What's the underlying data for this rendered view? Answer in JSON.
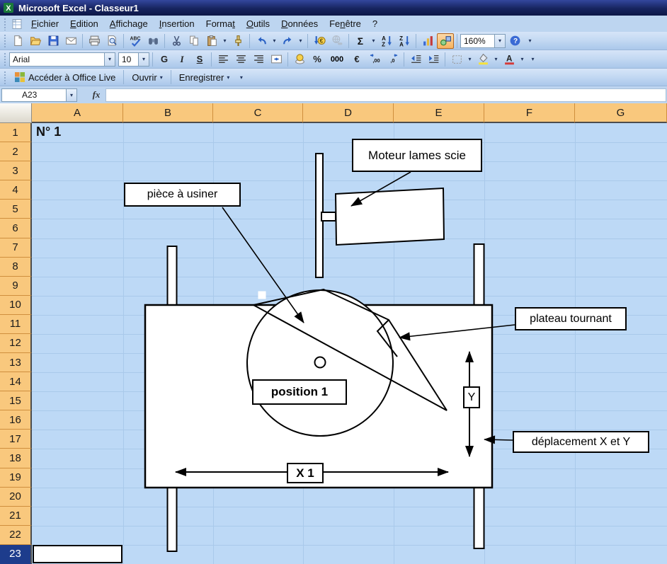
{
  "window_title": "Microsoft Excel - Classeur1",
  "menu_items": [
    {
      "label": "Fichier",
      "u": 0
    },
    {
      "label": "Edition",
      "u": 0
    },
    {
      "label": "Affichage",
      "u": 0
    },
    {
      "label": "Insertion",
      "u": 0
    },
    {
      "label": "Format",
      "u": 5
    },
    {
      "label": "Outils",
      "u": 0
    },
    {
      "label": "Données",
      "u": 0
    },
    {
      "label": "Fenêtre",
      "u": 2
    },
    {
      "label": "?",
      "u": -1
    }
  ],
  "standard_toolbar": {
    "zoom_value": "160%"
  },
  "formatting_toolbar": {
    "font_name": "Arial",
    "font_size": "10",
    "bold_label": "G",
    "italic_label": "I",
    "underline_label": "S",
    "percent": "%",
    "thousands": "000",
    "euro": "€"
  },
  "office_live_toolbar": {
    "access": "Accéder à Office Live",
    "open": "Ouvrir",
    "save": "Enregistrer"
  },
  "formula_bar": {
    "name_box": "A23",
    "fx": "fx",
    "formula": ""
  },
  "grid": {
    "columns": [
      "A",
      "B",
      "C",
      "D",
      "E",
      "F",
      "G"
    ],
    "rows": 23,
    "active_row": 23,
    "active_cell": "A23",
    "cell_a1": "N° 1"
  },
  "diagram": {
    "labels": {
      "moteur": "Moteur lames scie",
      "piece": "pièce à usiner",
      "plateau": "plateau tournant",
      "deplacement": "déplacement X et Y",
      "position": "position 1",
      "x1": "X 1",
      "y": "Y"
    }
  },
  "icons": {
    "dropdown": "▾",
    "sigma": "Σ",
    "euro": "€",
    "question": "?",
    "abc": "ABC",
    "sort_a": "A",
    "sort_z": "Z",
    "letter_a": "A",
    "x": "X",
    "dec0": ",0",
    "dec00": ",00"
  },
  "colors": {
    "header_orange": "#f9c87d",
    "cell_blue": "#bdd9f6",
    "active_row_header": "#1d3c8c",
    "titlebar_navy": "#17245f"
  }
}
